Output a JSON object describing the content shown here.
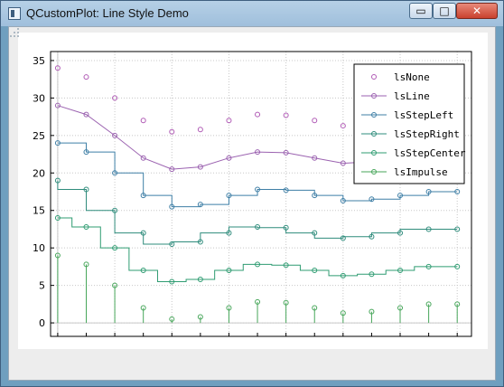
{
  "window": {
    "title": "QCustomPlot: Line Style Demo",
    "minimize_glyph": "▭",
    "maximize_glyph": "□",
    "close_glyph": "✕"
  },
  "colors": {
    "lsNone": "#b05ab5",
    "lsLine": "#9b62b0",
    "lsStepLeft": "#3f7fa6",
    "lsStepRight": "#2f8c7c",
    "lsStepCenter": "#2f9c72",
    "lsImpulse": "#47a65a"
  },
  "chart_data": {
    "type": "line",
    "x": [
      0,
      1,
      2,
      3,
      4,
      5,
      6,
      7,
      8,
      9,
      10,
      11,
      12,
      13,
      14
    ],
    "xlim": [
      -0.25,
      14.5
    ],
    "ylim": [
      -1.8,
      36.2
    ],
    "yticks": [
      "0",
      "5",
      "10",
      "15",
      "20",
      "25",
      "30",
      "35"
    ],
    "grid": true,
    "legend": {
      "placement": "top-right",
      "entries": [
        "lsNone",
        "lsLine",
        "lsStepLeft",
        "lsStepRight",
        "lsStepCenter",
        "lsImpulse"
      ]
    },
    "series": [
      {
        "name": "lsNone",
        "style": "none",
        "values": [
          34,
          32.8,
          30,
          27,
          25.5,
          25.8,
          27,
          27.8,
          27.7,
          27,
          26.3,
          26.5,
          27,
          27.5,
          27.5
        ]
      },
      {
        "name": "lsLine",
        "style": "line",
        "values": [
          29,
          27.8,
          25,
          22,
          20.5,
          20.8,
          22,
          22.8,
          22.7,
          22,
          21.3,
          21.5,
          22,
          22.5,
          22.5
        ]
      },
      {
        "name": "lsStepLeft",
        "style": "stepLeft",
        "values": [
          24,
          22.8,
          20,
          17,
          15.5,
          15.8,
          17,
          17.8,
          17.7,
          17,
          16.3,
          16.5,
          17,
          17.5,
          17.5
        ]
      },
      {
        "name": "lsStepRight",
        "style": "stepRight",
        "values": [
          19,
          17.8,
          15,
          12,
          10.5,
          10.8,
          12,
          12.8,
          12.7,
          12,
          11.3,
          11.5,
          12,
          12.5,
          12.5
        ]
      },
      {
        "name": "lsStepCenter",
        "style": "stepCenter",
        "values": [
          14,
          12.8,
          10,
          7,
          5.5,
          5.8,
          7,
          7.8,
          7.7,
          7,
          6.3,
          6.5,
          7,
          7.5,
          7.5
        ]
      },
      {
        "name": "lsImpulse",
        "style": "impulse",
        "values": [
          9,
          7.8,
          5,
          2,
          0.5,
          0.8,
          2,
          2.8,
          2.7,
          2,
          1.3,
          1.5,
          2,
          2.5,
          2.5
        ]
      }
    ]
  }
}
